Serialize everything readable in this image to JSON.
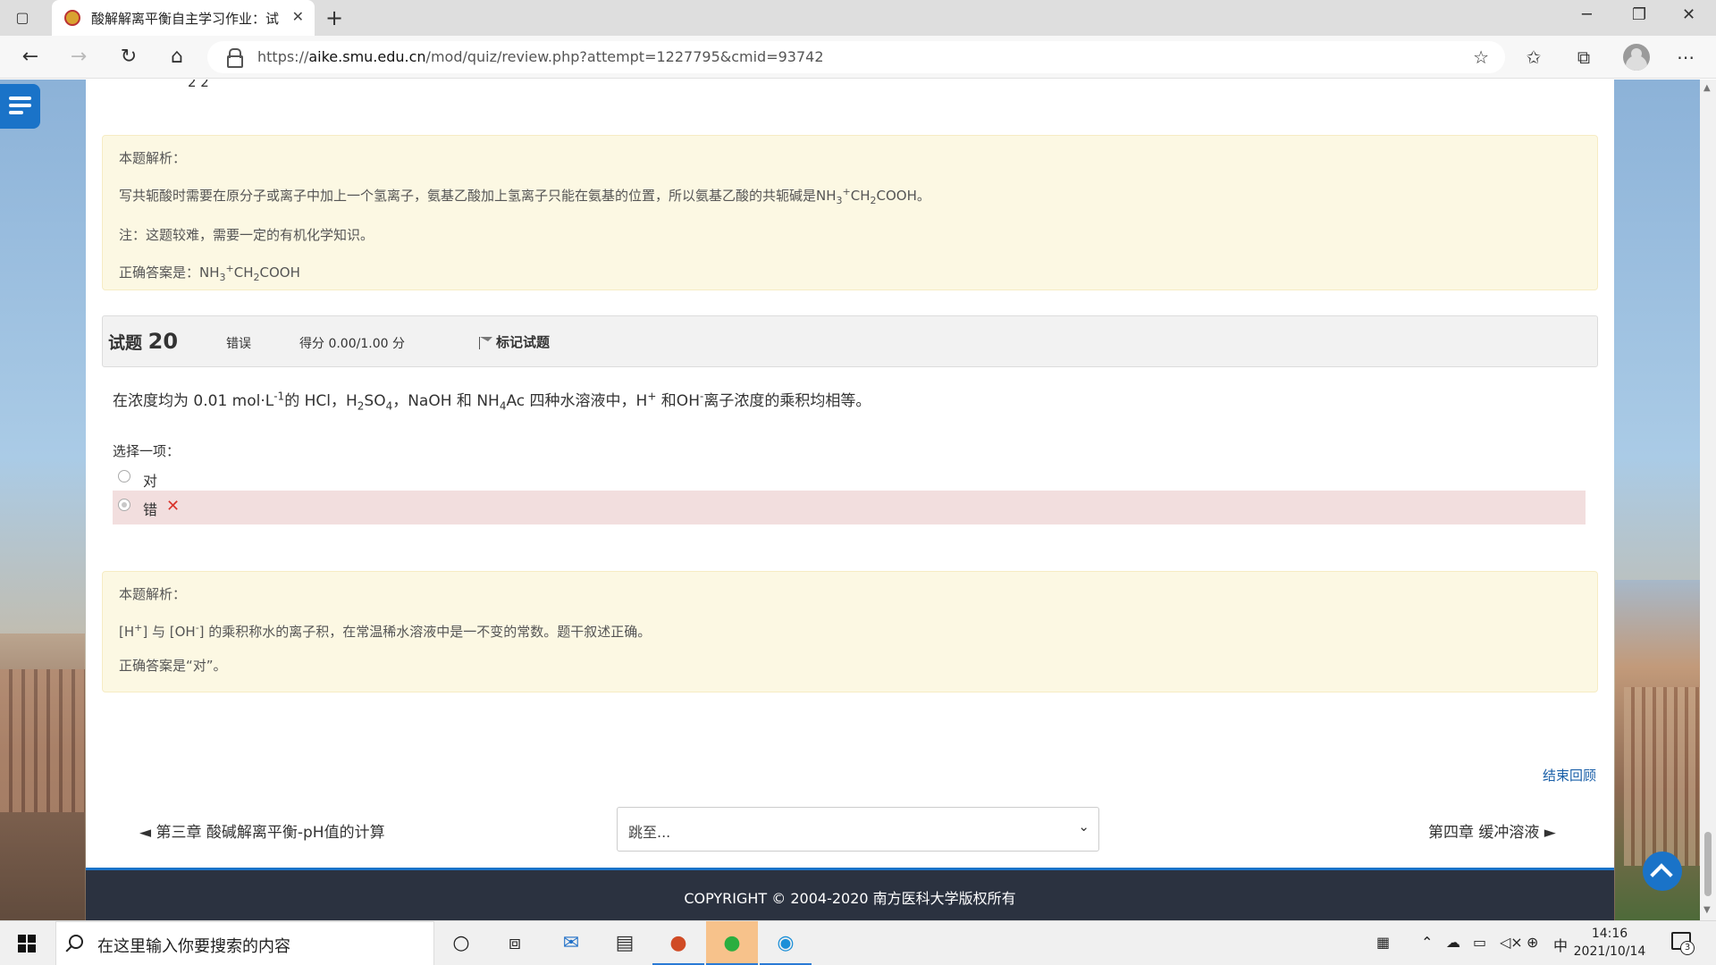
{
  "browser": {
    "tab_title": "酸解解离平衡自主学习作业：试卷",
    "tab_close": "✕",
    "new_tab": "+",
    "url_scheme": "https://",
    "url_host": "aike.smu.edu.cn",
    "url_path": "/mod/quiz/review.php?attempt=1227795&cmid=93742"
  },
  "previous_question": {
    "fragment": "2    2",
    "feedback": {
      "heading": "本题解析：",
      "line1_pre": "写共轭酸时需要在原分子或离子中加上一个氢离子，氨基乙酸加上氢离子只能在氨基的位置，所以氨基乙酸的共轭碱是NH",
      "line1_sub1": "3",
      "line1_sup": "+",
      "line1_mid": "CH",
      "line1_sub2": "2",
      "line1_post": "COOH。",
      "note": "注：这题较难，需要一定的有机化学知识。",
      "answer_pre": "正确答案是：NH",
      "answer_sub1": "3",
      "answer_sup": "+",
      "answer_mid": "CH",
      "answer_sub2": "2",
      "answer_post": "COOH"
    }
  },
  "question": {
    "label": "试题",
    "number": "20",
    "state": "错误",
    "grade": "得分 0.00/1.00 分",
    "flag_label": "标记试题",
    "text_1": "在浓度均为 0.01 mol·L",
    "text_sup1": "-1",
    "text_2": "的 HCl，H",
    "text_sub1": "2",
    "text_3": "SO",
    "text_sub2": "4",
    "text_4": "，NaOH 和 NH",
    "text_sub3": "4",
    "text_5": "Ac 四种水溶液中，H",
    "text_sup2": "+",
    "text_6": " 和OH",
    "text_sup3": "-",
    "text_7": "离子浓度的乘积均相等。",
    "prompt": "选择一项：",
    "options": [
      {
        "label": "对"
      },
      {
        "label": "错"
      }
    ],
    "incorrect_mark": "✕"
  },
  "feedback": {
    "heading": "本题解析：",
    "line1_a": "[H",
    "line1_sup1": "+",
    "line1_b": "] 与 [OH",
    "line1_sup2": "-",
    "line1_c": "] 的乘积称水的离子积，在常温稀水溶液中是一不变的常数。题干叙述正确。",
    "answer": "正确答案是“对”。"
  },
  "navigation": {
    "end_review": "结束回顾",
    "prev": "◄ 第三章 酸碱解离平衡-pH值的计算",
    "jump_placeholder": "跳至...",
    "next": "第四章 缓冲溶液 ►"
  },
  "footer": {
    "copyright": "COPYRIGHT © 2004-2020 南方医科大学版权所有"
  },
  "taskbar": {
    "search_placeholder": "在这里输入你要搜索的内容",
    "ime": "中",
    "time": "14:16",
    "date": "2021/10/14",
    "notifications": "3"
  },
  "colors": {
    "accent": "#1a73c8",
    "feedback_bg": "#fcf8e3",
    "incorrect_bg": "#f2dede",
    "incorrect_mark": "#d9342b",
    "footer_bg": "#2b3240"
  }
}
